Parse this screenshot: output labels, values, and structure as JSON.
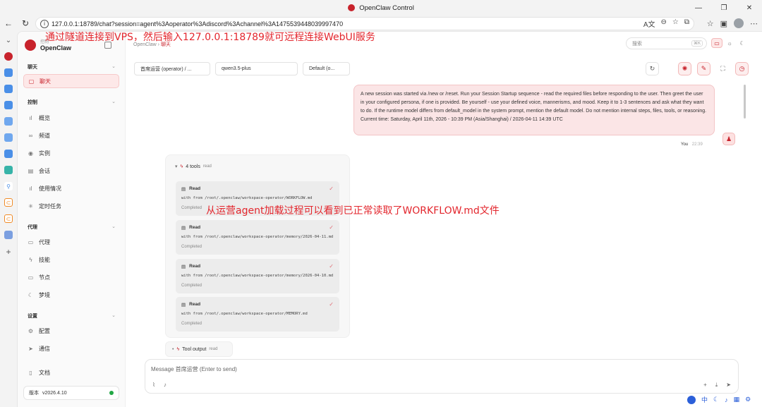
{
  "browser": {
    "window_title": "OpenClaw Control",
    "url": "127.0.0.1:18789/chat?session=agent%3Aoperator%3Adiscord%3Achannel%3A1475539448039997470"
  },
  "sidebar": {
    "brand_sub": "控制",
    "brand_name": "OpenClaw",
    "sections": [
      {
        "title": "聊天",
        "items": [
          {
            "label": "聊天",
            "icon": "chat-icon",
            "active": true
          }
        ]
      },
      {
        "title": "控制",
        "items": [
          {
            "label": "概览",
            "icon": "bar-chart-icon"
          },
          {
            "label": "频道",
            "icon": "link-icon"
          },
          {
            "label": "实例",
            "icon": "broadcast-icon"
          },
          {
            "label": "会话",
            "icon": "document-icon"
          },
          {
            "label": "使用情况",
            "icon": "bar-chart-icon"
          },
          {
            "label": "定时任务",
            "icon": "loader-icon"
          }
        ]
      },
      {
        "title": "代理",
        "items": [
          {
            "label": "代理",
            "icon": "folder-icon"
          },
          {
            "label": "技能",
            "icon": "bolt-icon"
          },
          {
            "label": "节点",
            "icon": "monitor-icon"
          },
          {
            "label": "梦境",
            "icon": "moon-icon"
          }
        ]
      },
      {
        "title": "设置",
        "items": [
          {
            "label": "配置",
            "icon": "gear-icon"
          },
          {
            "label": "通信",
            "icon": "send-icon"
          }
        ]
      }
    ],
    "docs_label": "文档",
    "version_label": "版本",
    "version": "v2026.4.10"
  },
  "header": {
    "breadcrumb_root": "OpenClaw",
    "breadcrumb_sep": "›",
    "breadcrumb_current": "聊天",
    "search_placeholder": "搜索",
    "search_shortcut": "⌘K"
  },
  "selectors": {
    "agent": "首席运营 (operator) / ...",
    "model": "qwen3.5-plus",
    "mode": "Default (o..."
  },
  "user_message": {
    "text": "A new session was started via /new or /reset. Run your Session Startup sequence - read the required files before responding to the user. Then greet the user in your configured persona, if one is provided. Be yourself - use your defined voice, mannerisms, and mood. Keep it to 1-3 sentences and ask what they want to do. If the runtime model differs from default_model in the system prompt, mention the default model. Do not mention internal steps, files, tools, or reasoning.",
    "current_time": "Current time: Saturday, April 11th, 2026 - 10:39 PM (Asia/Shanghai) / 2026-04-11 14:39 UTC",
    "sender": "You",
    "time": "22:39"
  },
  "tool_group": {
    "count_label": "4 tools",
    "kind": "read",
    "items": [
      {
        "title": "Read",
        "path": "with from /root/.openclaw/workspace-operator/WORKFLOW.md",
        "status": "Completed"
      },
      {
        "title": "Read",
        "path": "with from /root/.openclaw/workspace-operator/memory/2026-04-11.md",
        "status": "Completed"
      },
      {
        "title": "Read",
        "path": "with from /root/.openclaw/workspace-operator/memory/2026-04-10.md",
        "status": "Completed"
      },
      {
        "title": "Read",
        "path": "with from /root/.openclaw/workspace-operator/MEMORY.md",
        "status": "Completed"
      }
    ]
  },
  "tool_output": {
    "label": "Tool output",
    "kind": "read"
  },
  "composer": {
    "placeholder": "Message 首席运营 (Enter to send)"
  },
  "annotations": {
    "top": "通过隧道连接到VPS，然后输入127.0.0.1:18789就可远程连接WebUI服务",
    "middle": "从运营agent加载过程可以看到已正常读取了WORKFLOW.md文件"
  },
  "taskbar": {
    "ime": "中"
  },
  "colors": {
    "accent": "#c8232c",
    "annotation": "#e3262d",
    "user_bubble": "#fbe5e6"
  }
}
